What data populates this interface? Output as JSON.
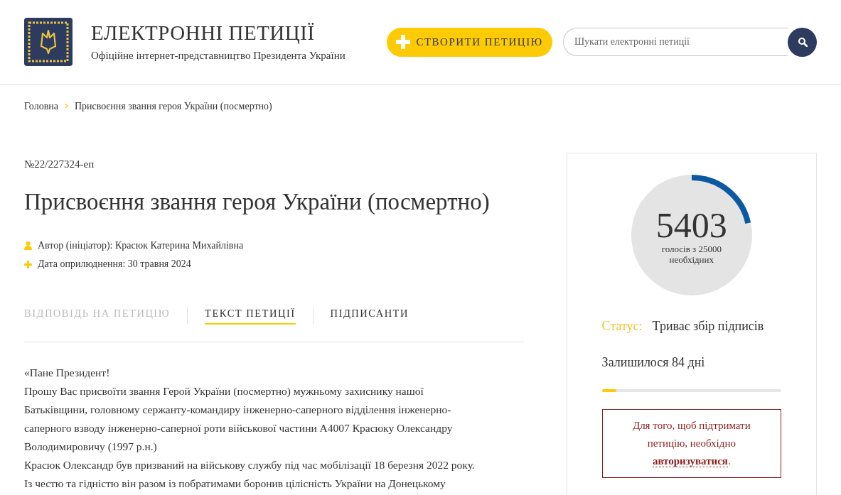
{
  "header": {
    "title": "ЕЛЕКТРОННІ ПЕТИЦІЇ",
    "subtitle": "Офіційне інтернет-представництво Президента України",
    "create_button": "СТВОРИТИ ПЕТИЦІЮ",
    "search": {
      "placeholder": "Шукати електронні петиції"
    }
  },
  "breadcrumbs": [
    "Головна",
    "Присвоєння звання героя України (посмертно)"
  ],
  "petition": {
    "number": "№22/227324-еп",
    "title": "Присвоєння звання героя України (посмертно)",
    "meta": [
      {
        "kind": "author",
        "text": "Автор (ініціатор): Красюк Катерина Михайлівна"
      },
      {
        "kind": "date",
        "text": "Дата оприлюднення: 30 травня 2024"
      }
    ],
    "tabs": [
      {
        "label": "ВІДПОВІДЬ НА ПЕТИЦІЮ",
        "selected": false,
        "disabled": true
      },
      {
        "label": "ТЕКСТ ПЕТИЦІЇ",
        "selected": true,
        "disabled": false
      },
      {
        "label": "ПІДПИСАНТИ",
        "selected": false,
        "disabled": false
      }
    ],
    "text_lines": [
      "«Пане Президент!",
      "Прошу Вас присвоїти звання Герой України (посмертно) мужньому захиснику нашої",
      "Батьківщини, головному сержанту-командиру інженерно-саперного відділення інженерно-",
      "саперного взводу інженерно-саперної роти військової частини А4007 Красюку Олександру",
      "Володимировичу (1997 р.н.)",
      "Красюк Олександр був призваний на військову службу під час мобілізації 18 березня 2022 року.",
      "Із честю та гідністю він разом із побратимами боронив цілісність України на Донецькому"
    ]
  },
  "sidebar": {
    "votes": {
      "count": "5403",
      "caption_1": "голосів з 25000",
      "caption_2": "необхідних"
    },
    "status_label": "Статус:",
    "status_value": "Триває збір підписів",
    "remaining": {
      "text": "Залишилося 84 дні",
      "level": 0.08
    },
    "notice": {
      "text": "Для того, щоб підтримати петицію, необхідно",
      "link": "авторизуватися",
      "end": "."
    }
  }
}
